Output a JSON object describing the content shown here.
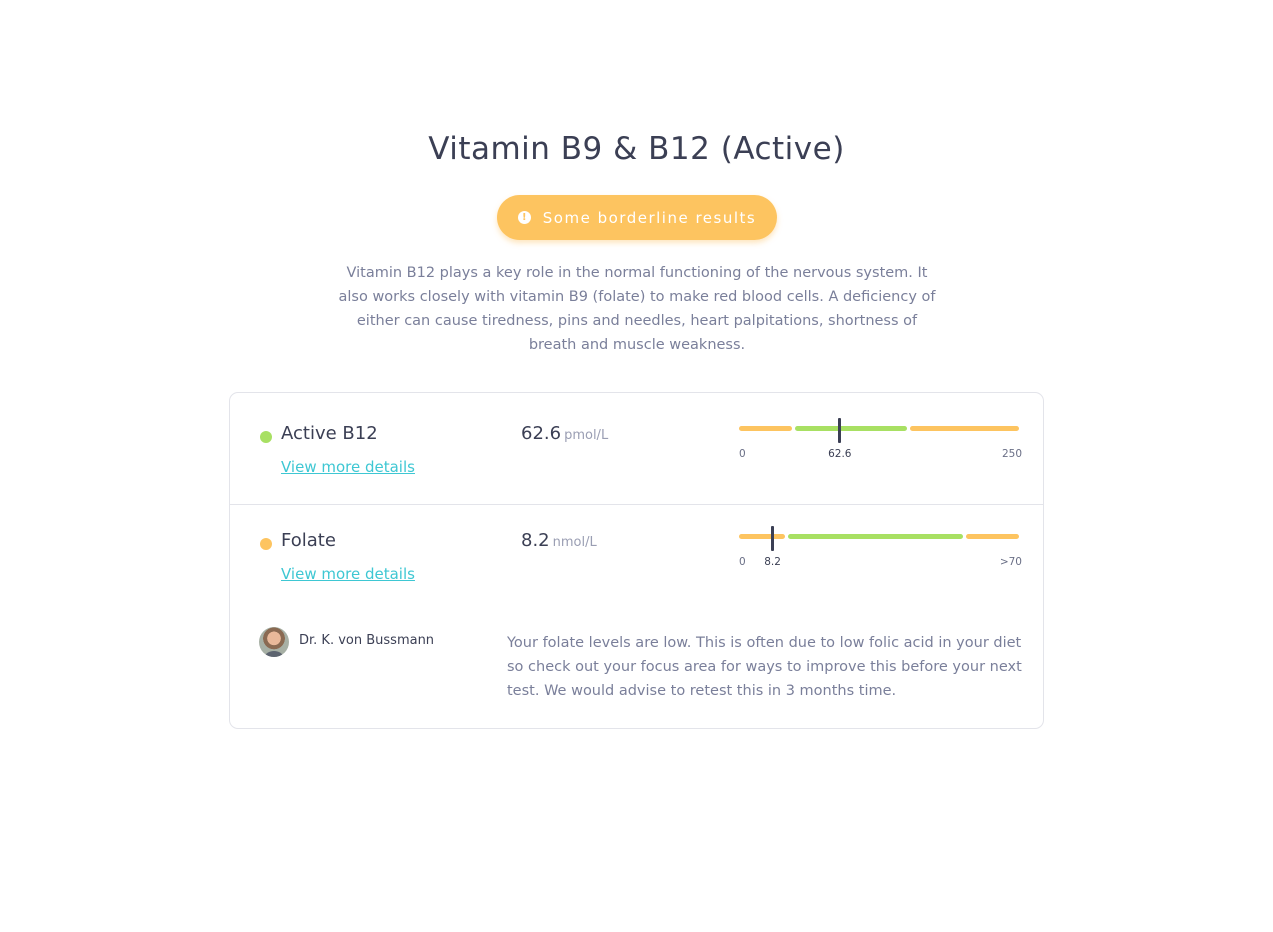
{
  "page": {
    "title": "Vitamin B9 & B12 (Active)",
    "status_label": "Some borderline results",
    "status_icon": "warning-icon",
    "status_color": "#fdc460",
    "description": "Vitamin B12 plays a key role in the normal functioning of the nervous system. It also works closely with vitamin B9 (folate) to make red blood cells. A deficiency of either can cause tiredness, pins and needles, heart palpitations, shortness of breath and muscle weakness."
  },
  "colors": {
    "normal": "#a8e063",
    "borderline": "#fdc460",
    "link": "#3ec7d3"
  },
  "markers": [
    {
      "name": "Active B12",
      "status": "normal",
      "value": "62.6",
      "unit": "pmol/L",
      "details_link": "View more details",
      "range_min_label": "0",
      "range_max_label": "250",
      "current_label": "62.6",
      "bands": [
        {
          "status": "borderline",
          "from": 0,
          "to": 0.195
        },
        {
          "status": "normal",
          "from": 0.195,
          "to": 0.605
        },
        {
          "status": "borderline",
          "from": 0.605,
          "to": 1.0
        }
      ],
      "current_fraction": 0.36
    },
    {
      "name": "Folate",
      "status": "borderline",
      "value": "8.2",
      "unit": "nmol/L",
      "details_link": "View more details",
      "range_min_label": "0",
      "range_max_label": ">70",
      "current_label": "8.2",
      "bands": [
        {
          "status": "borderline",
          "from": 0,
          "to": 0.17
        },
        {
          "status": "normal",
          "from": 0.17,
          "to": 0.805
        },
        {
          "status": "borderline",
          "from": 0.805,
          "to": 1.0
        }
      ],
      "current_fraction": 0.12
    }
  ],
  "doctor": {
    "name": "Dr. K. von Bussmann",
    "note": "Your folate levels are low. This is often due to low folic acid in your diet so check out your focus area for ways to improve this before your next test. We would advise to retest this in 3 months time."
  }
}
